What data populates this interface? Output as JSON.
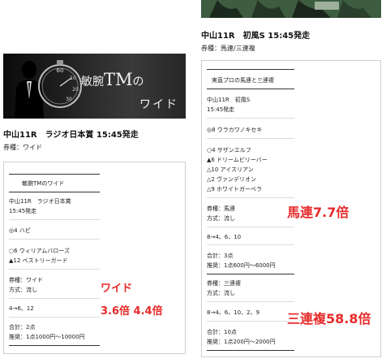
{
  "left": {
    "banner": {
      "title_prefix": "敏腕",
      "title_tm": "TM",
      "title_no": "の",
      "title_line2": "ワイド"
    },
    "race_title": "中山11R　ラジオ日本賞 15:45発走",
    "ticket_type": "券種：ワイド",
    "card": {
      "header": "敏腕TMのワイド",
      "race": "中山11R　ラジオ日本賞",
      "time": "15:45発走",
      "pick1": "◎4 ハピ",
      "pick2": "○6 ウィリアムバローズ",
      "pick3": "▲12 ベストリーガード",
      "ticket": "券種：ワイド",
      "method": "方式：流し",
      "combo": "4→6、12",
      "total": "合計：2点",
      "recommend": "推奨：1点1000円〜10000円"
    },
    "overlay_type": "ワイド",
    "overlay_odds": "3.6倍 4.4倍"
  },
  "right": {
    "race_title": "中山11R　初風S 15:45発走",
    "ticket_type": "券種：馬連/三連複",
    "card": {
      "header": "実直プロの馬連と三連複",
      "race": "中山11R　初風S",
      "time": "15:45発走",
      "pick1": "◎8 ウラカワノキセキ",
      "pick2": "○4 サザンエルフ",
      "pick3": "▲6 ドリームビリーバー",
      "pick4": "△10 アイスリアン",
      "pick5": "△2 ヴァンデリオン",
      "pick6": "△9 ホワイトガーベラ",
      "ticket1": "券種：馬連",
      "method1": "方式：流し",
      "combo1": "8→4、6、10",
      "total1": "合計：3点",
      "recommend1": "推奨：1点600円〜6000円",
      "ticket2": "券種：三連複",
      "method2": "方式：流し",
      "combo2": "8→4、6、10、2、9",
      "total2": "合計：10点",
      "recommend2": "推奨：1点200円〜2000円"
    },
    "overlay_umaren": "馬連7.7倍",
    "overlay_sanrenpuku": "三連複58.8倍"
  },
  "colors": {
    "accent_red": "#e82a2a"
  }
}
